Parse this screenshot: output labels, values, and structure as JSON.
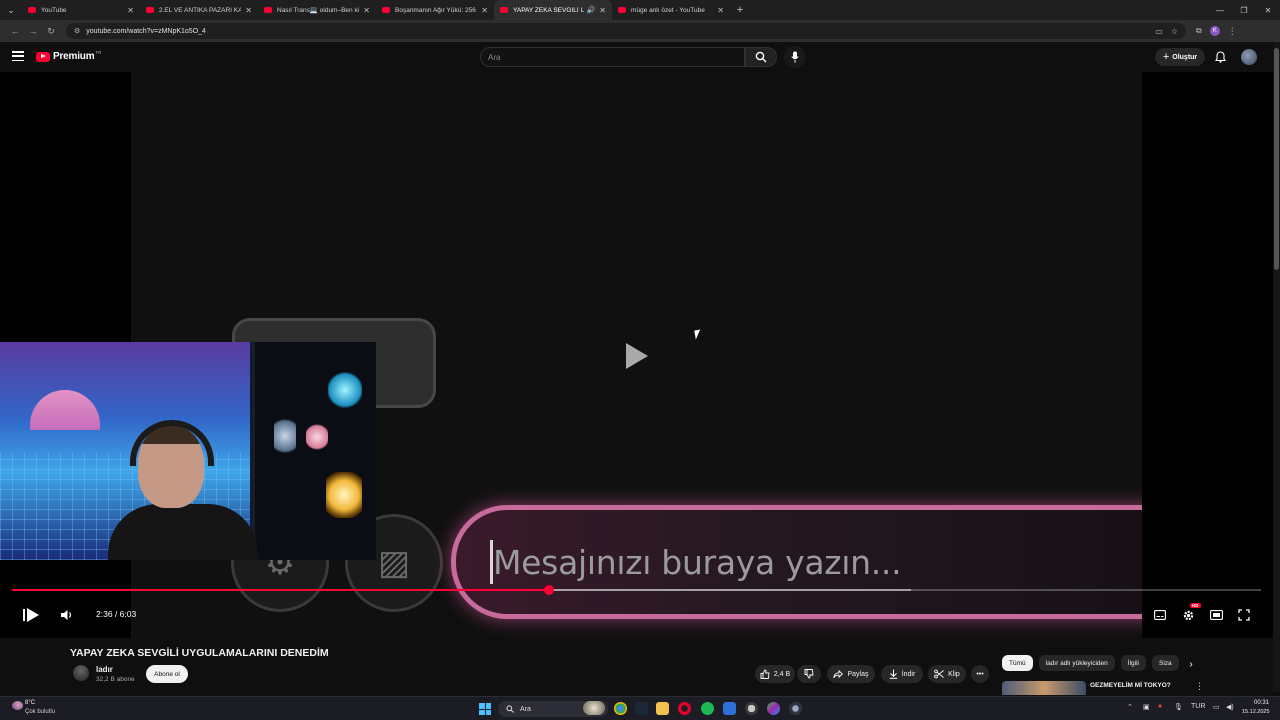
{
  "browser": {
    "tabs": [
      {
        "label": "YouTube",
        "active": false
      },
      {
        "label": "2.EL VE ANTİKA PAZARI KARŞI",
        "active": false
      },
      {
        "label": "Nasıl Trans💻 oldum–Ben kims",
        "active": false
      },
      {
        "label": "Boşanmanın Ağır Yükü: 256 Ki",
        "active": false
      },
      {
        "label": "YAPAY ZEKA SEVGİLİ UYGU",
        "active": true
      },
      {
        "label": "müge anlı özet - YouTube",
        "active": false
      }
    ],
    "url": "youtube.com/watch?v=zMNpK1o5O_4",
    "profile_initial": "K"
  },
  "header": {
    "logo_text": "Premium",
    "logo_region": "TR",
    "search_placeholder": "Ara",
    "create_label": "Oluştur"
  },
  "video": {
    "overlay_text": "Mesajınızı buraya yazın...",
    "current_time": "2:36",
    "duration": "6:03",
    "time_display": "2:36 / 6:03",
    "progress_fraction": 0.43,
    "buffer_fraction": 0.72,
    "hd_badge": "HD",
    "accent_color": "#ff0033"
  },
  "meta": {
    "title": "YAPAY ZEKA SEVGİLİ UYGULAMALARINI DENEDİM",
    "channel_name": "ladır",
    "subscribers": "32,2 B abone",
    "subscribe_label": "Abone ol",
    "likes": "2,4 B",
    "share_label": "Paylaş",
    "download_label": "İndir",
    "clip_label": "Klip"
  },
  "recommendations": {
    "chips": [
      "Tümü",
      "ladır adlı yükleyiciden",
      "İlgili",
      "Siza"
    ],
    "first_title": "GEZMEYELİM Mİ TOKYO?"
  },
  "taskbar": {
    "weather_temp": "8°C",
    "weather_desc": "Çok bulutlu",
    "search_label": "Ara",
    "language": "TUR",
    "time": "00:31",
    "date": "15.12.2025"
  }
}
